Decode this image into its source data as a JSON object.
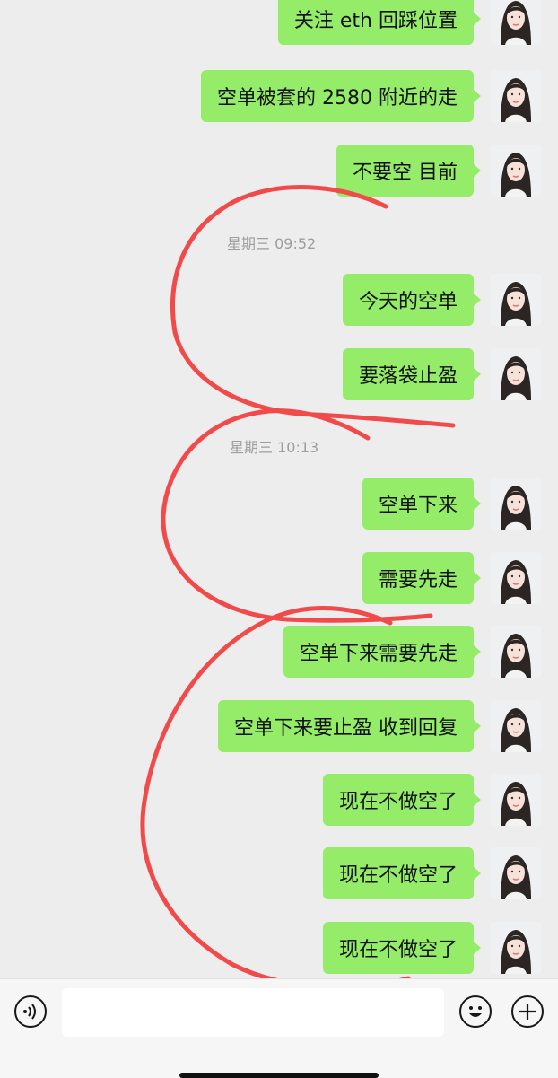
{
  "chat": {
    "messages": [
      {
        "text": "关注 eth 回踩位置"
      },
      {
        "text": "空单被套的 2580 附近的走"
      },
      {
        "text": "不要空 目前"
      },
      {
        "text": "今天的空单"
      },
      {
        "text": "要落袋止盈"
      },
      {
        "text": "空单下来"
      },
      {
        "text": "需要先走"
      },
      {
        "text": "空单下来需要先走"
      },
      {
        "text": "空单下来要止盈 收到回复"
      },
      {
        "text": "现在不做空了"
      },
      {
        "text": "现在不做空了"
      },
      {
        "text": "现在不做空了"
      }
    ],
    "timestamps": [
      "星期三 09:52",
      "星期三 10:13"
    ]
  },
  "input_bar": {
    "voice_icon": "voice-icon",
    "emoji_icon": "emoji-icon",
    "plus_icon": "plus-icon",
    "text_value": ""
  },
  "colors": {
    "bubble": "#95ec69",
    "background": "#ededed",
    "annotation": "#f04a4a",
    "timestamp": "#9d9d9d"
  }
}
